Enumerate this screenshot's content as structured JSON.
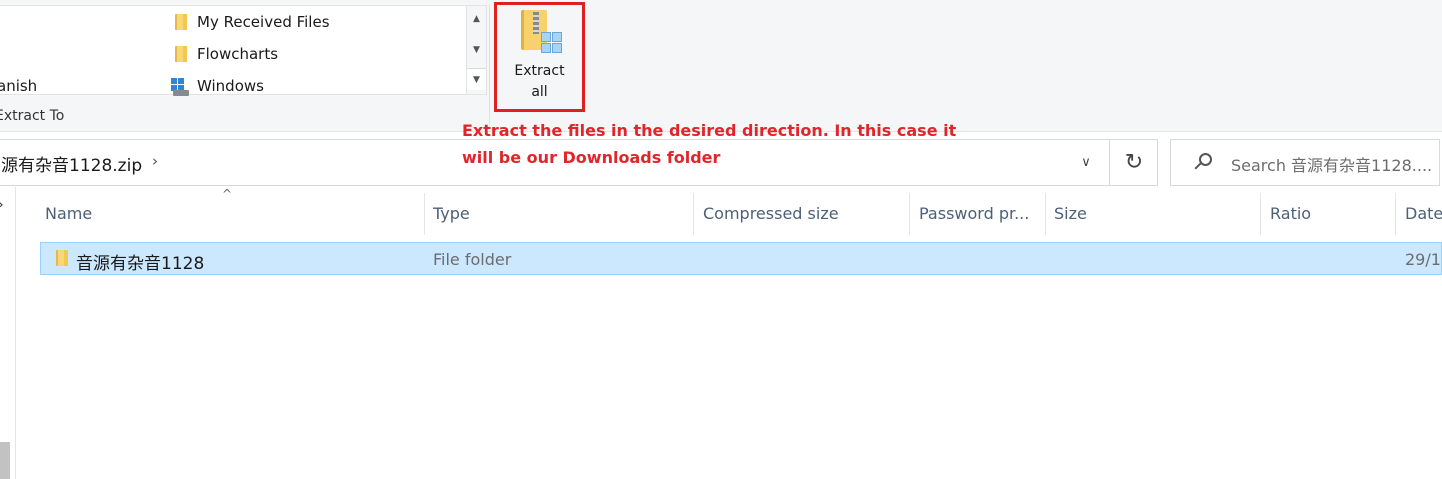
{
  "ribbon": {
    "gallery_items": [
      {
        "label": "My Received Files",
        "icon": "folder-icon"
      },
      {
        "label": "Flowcharts",
        "icon": "folder-icon"
      },
      {
        "label": "Windows",
        "icon": "windows-drive-icon"
      }
    ],
    "left_partial_label": "anish",
    "group_label": "Extract To",
    "extract_all_line1": "Extract",
    "extract_all_line2": "all"
  },
  "annotation": {
    "line1": "Extract the files in the desired direction. In this case it",
    "line2": "will be our Downloads folder",
    "color": "#e0262a"
  },
  "address": {
    "crumb": "源有杂音1128.zip",
    "search_placeholder": "Search 音源有杂音1128...."
  },
  "columns": [
    "Name",
    "Type",
    "Compressed size",
    "Password pr...",
    "Size",
    "Ratio",
    "Date"
  ],
  "rows": [
    {
      "name": "音源有杂音1128",
      "type": "File folder",
      "date": "29/1"
    }
  ],
  "colors": {
    "selection": "#cce8ff",
    "annotation_border": "#e02020",
    "header_text": "#4c607a"
  }
}
